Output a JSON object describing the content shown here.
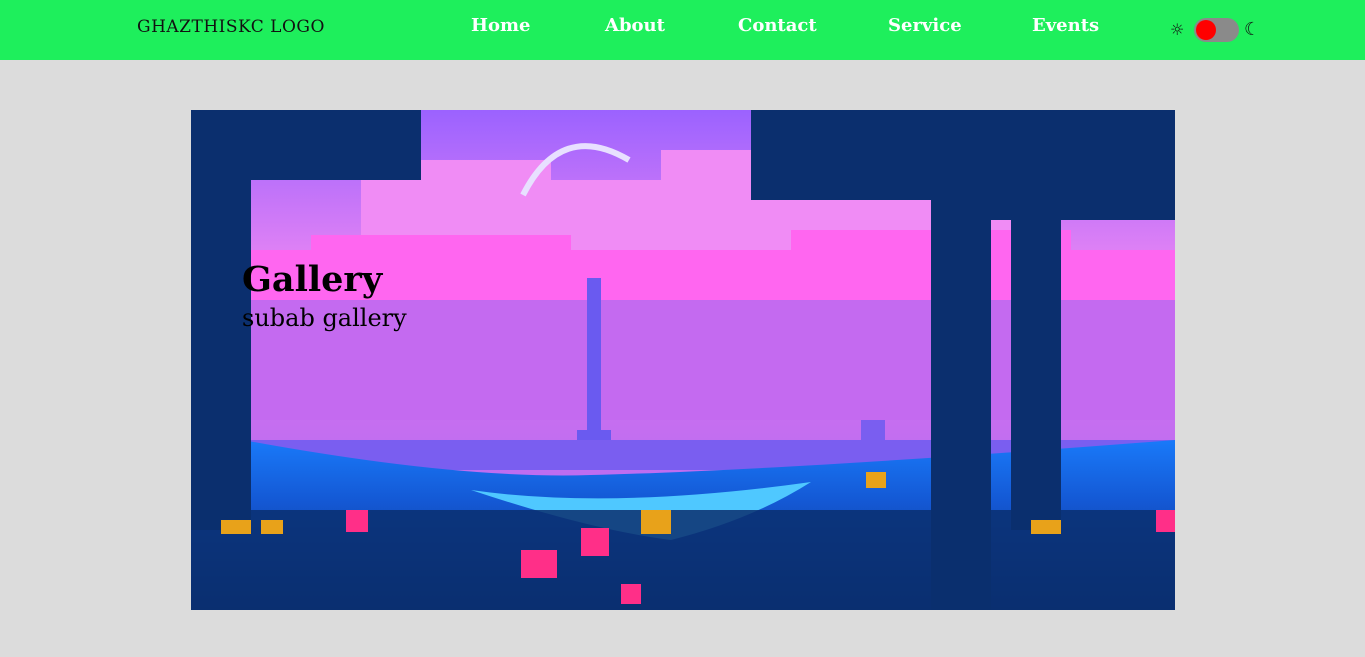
{
  "nav": {
    "logo": "GHAZTHISKC LOGO",
    "links": [
      "Home",
      "About",
      "Contact",
      "Service",
      "Events"
    ]
  },
  "theme_toggle": {
    "light_icon": "sun-icon",
    "dark_icon": "moon-icon",
    "knob_color": "#ff0000",
    "track_color": "#8a8a8a"
  },
  "hero": {
    "title": "Gallery",
    "subtitle": "subab gallery"
  },
  "colors": {
    "navbar": "#1eef5c",
    "page_background": "#dcdcdc"
  }
}
